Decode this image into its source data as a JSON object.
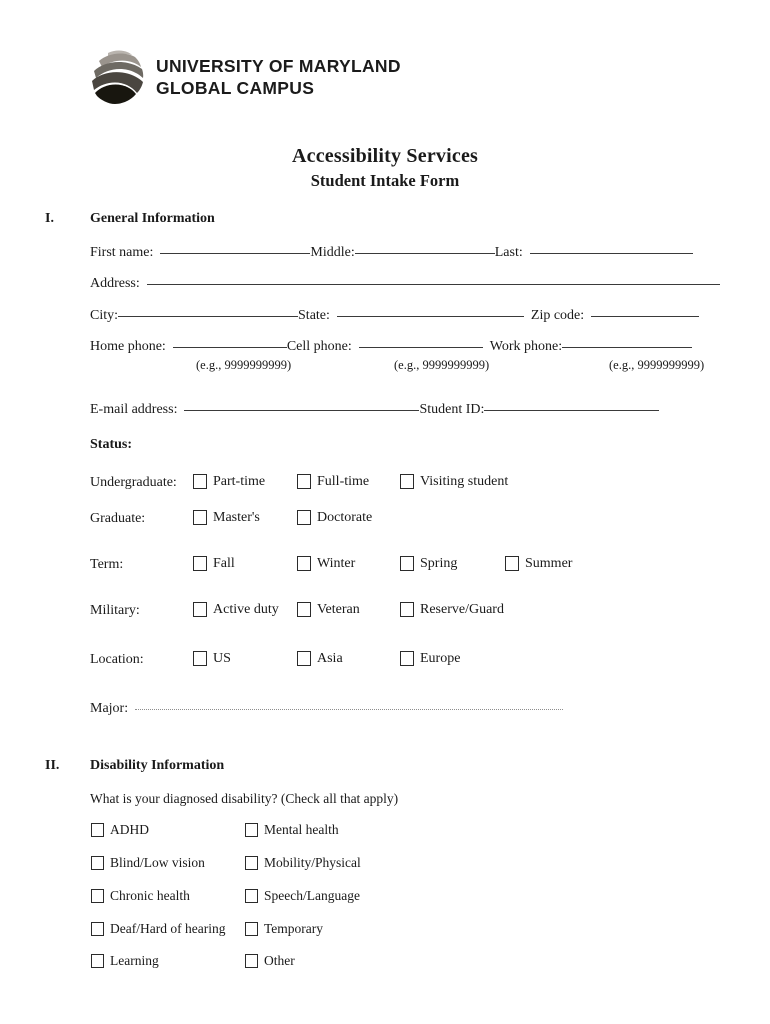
{
  "logo": {
    "icon": "umgc-globe-logo",
    "line1": "UNIVERSITY OF MARYLAND",
    "line2": "GLOBAL CAMPUS"
  },
  "title": "Accessibility Services",
  "subtitle": "Student Intake Form",
  "sections": [
    {
      "numeral": "I.",
      "heading": "General Information"
    },
    {
      "numeral": "II.",
      "heading": "Disability Information"
    }
  ],
  "general": {
    "name_row": {
      "first_label": "First name:",
      "middle_label": "Middle:",
      "last_label": "Last:",
      "first_value": "",
      "middle_value": "",
      "last_value": ""
    },
    "address_label": "Address:",
    "address_value": "",
    "city_label": "City:",
    "city_value": "",
    "state_label": "State:",
    "state_value": "",
    "zip_label": "Zip code:",
    "zip_value": "",
    "home_phone_label": "Home phone:",
    "home_phone_value": "",
    "cell_phone_label": "Cell phone:",
    "cell_phone_value": "",
    "work_phone_label": "Work phone:",
    "work_phone_value": "",
    "phone_hint_home": "(e.g., 9999999999)",
    "phone_hint_cell": "(e.g., 9999999999)",
    "phone_hint_work": "(e.g., 9999999999)",
    "email_label": "E-mail address:",
    "email_value": "",
    "student_id_label": "Student ID:",
    "student_id_value": "",
    "status_label": "Status:",
    "major_label": "Major:",
    "major_value": ""
  },
  "status_groups": [
    {
      "name": "undergraduate",
      "label": "Undergraduate:",
      "options": [
        {
          "label": "Part-time",
          "checked": false
        },
        {
          "label": "Full-time",
          "checked": false
        },
        {
          "label": "Visiting student",
          "checked": false
        }
      ]
    },
    {
      "name": "graduate",
      "label": "Graduate:",
      "options": [
        {
          "label": "Master's",
          "checked": false
        },
        {
          "label": "Doctorate",
          "checked": false
        }
      ]
    },
    {
      "name": "term",
      "label": "Term:",
      "options": [
        {
          "label": "Fall",
          "checked": false
        },
        {
          "label": "Winter",
          "checked": false
        },
        {
          "label": "Spring",
          "checked": false
        },
        {
          "label": "Summer",
          "checked": false
        }
      ]
    },
    {
      "name": "military",
      "label": "Military:",
      "options": [
        {
          "label": "Active duty",
          "checked": false
        },
        {
          "label": "Veteran",
          "checked": false
        },
        {
          "label": "Reserve/Guard",
          "checked": false
        }
      ]
    },
    {
      "name": "location",
      "label": "Location:",
      "options": [
        {
          "label": "US",
          "checked": false
        },
        {
          "label": "Asia",
          "checked": false
        },
        {
          "label": "Europe",
          "checked": false
        }
      ]
    }
  ],
  "disability": {
    "question": "What is your diagnosed disability? (Check all that apply)",
    "column_left": [
      {
        "label": "ADHD",
        "checked": false
      },
      {
        "label": "Blind/Low vision",
        "checked": false
      },
      {
        "label": "Chronic health",
        "checked": false
      },
      {
        "label": "Deaf/Hard of hearing",
        "checked": false
      },
      {
        "label": "Learning",
        "checked": false
      }
    ],
    "column_right": [
      {
        "label": "Mental health",
        "checked": false
      },
      {
        "label": "Mobility/Physical",
        "checked": false
      },
      {
        "label": "Speech/Language",
        "checked": false
      },
      {
        "label": "Temporary",
        "checked": false
      },
      {
        "label": "Other",
        "checked": false
      }
    ]
  },
  "colors": {
    "text": "#1a1a1a",
    "rule": "#3a3a3a",
    "dotted_rule": "#8d8d8d",
    "logo_dark": "#111111",
    "logo_mid": "#5c5750",
    "logo_light": "#b9b4ae"
  }
}
